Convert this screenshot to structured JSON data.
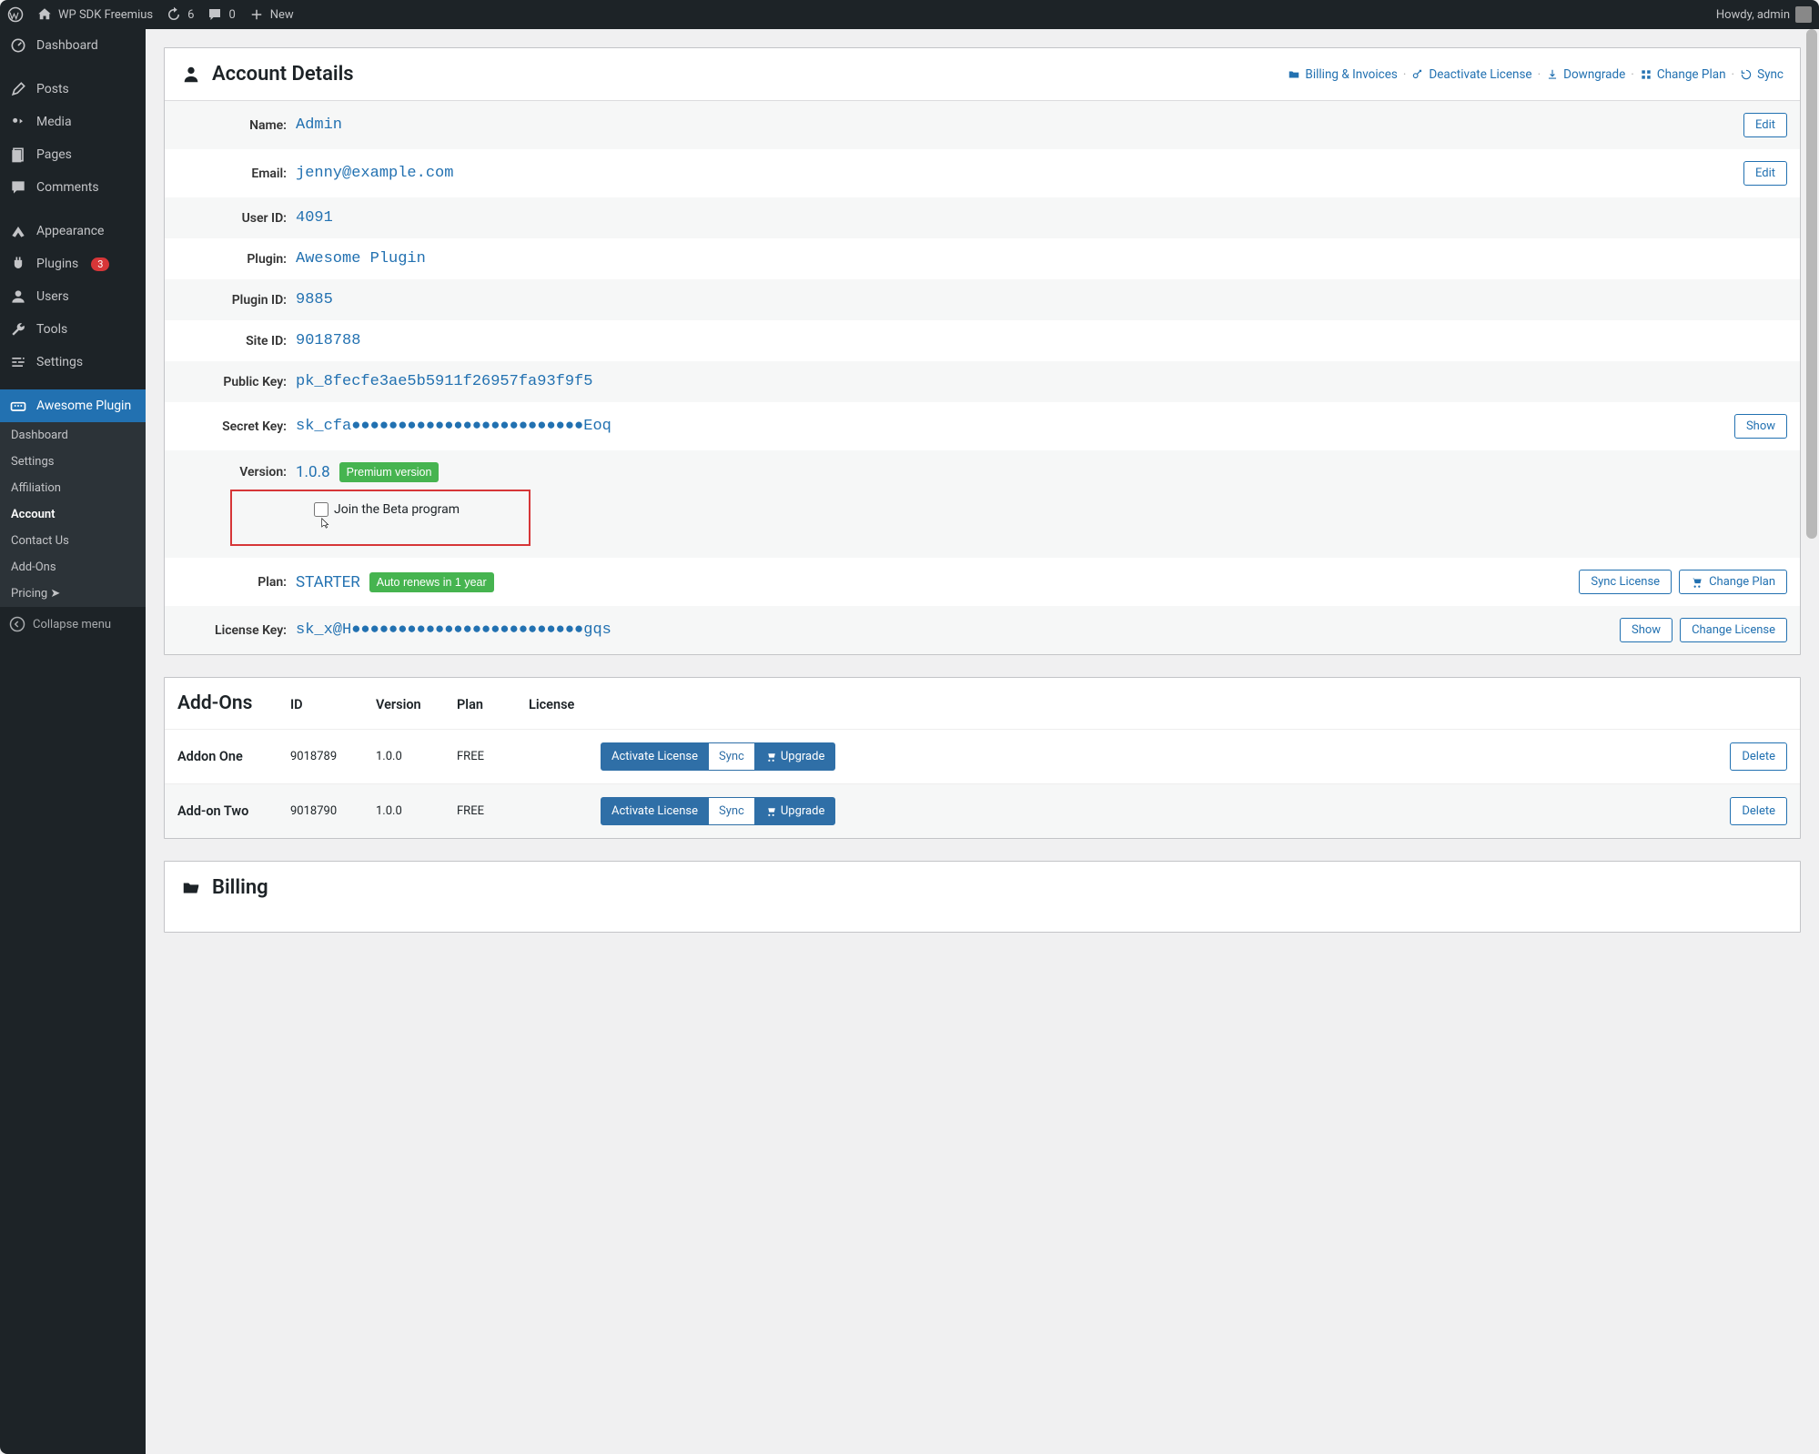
{
  "adminBar": {
    "siteName": "WP SDK Freemius",
    "updateCount": "6",
    "commentCount": "0",
    "newLabel": "New",
    "greeting": "Howdy, admin"
  },
  "sidebar": {
    "items": [
      {
        "label": "Dashboard"
      },
      {
        "label": "Posts"
      },
      {
        "label": "Media"
      },
      {
        "label": "Pages"
      },
      {
        "label": "Comments"
      },
      {
        "label": "Appearance"
      },
      {
        "label": "Plugins",
        "badge": "3"
      },
      {
        "label": "Users"
      },
      {
        "label": "Tools"
      },
      {
        "label": "Settings"
      },
      {
        "label": "Awesome Plugin"
      }
    ],
    "submenu": [
      {
        "label": "Dashboard"
      },
      {
        "label": "Settings"
      },
      {
        "label": "Affiliation"
      },
      {
        "label": "Account"
      },
      {
        "label": "Contact Us"
      },
      {
        "label": "Add-Ons"
      },
      {
        "label": "Pricing ➤"
      }
    ],
    "collapseLabel": "Collapse menu"
  },
  "accountDetails": {
    "title": "Account Details",
    "headerLinks": {
      "billing": "Billing & Invoices",
      "deactivate": "Deactivate License",
      "downgrade": "Downgrade",
      "changePlan": "Change Plan",
      "sync": "Sync"
    },
    "rows": {
      "nameLabel": "Name:",
      "nameValue": "Admin",
      "emailLabel": "Email:",
      "emailValue": "jenny@example.com",
      "userIdLabel": "User ID:",
      "userIdValue": "4091",
      "pluginLabel": "Plugin:",
      "pluginValue": "Awesome Plugin",
      "pluginIdLabel": "Plugin ID:",
      "pluginIdValue": "9885",
      "siteIdLabel": "Site ID:",
      "siteIdValue": "9018788",
      "publicKeyLabel": "Public Key:",
      "publicKeyValue": "pk_8fecfe3ae5b5911f26957fa93f9f5",
      "secretKeyLabel": "Secret Key:",
      "secretKeyValue": "sk_cfa●●●●●●●●●●●●●●●●●●●●●●●●●Eoq",
      "versionLabel": "Version:",
      "versionValue": "1.0.8",
      "versionBadge": "Premium version",
      "betaLabel": "Join the Beta program",
      "planLabel": "Plan:",
      "planValue": "STARTER",
      "planBadge": "Auto renews in 1 year",
      "licenseKeyLabel": "License Key:",
      "licenseKeyValue": "sk_x@H●●●●●●●●●●●●●●●●●●●●●●●●●gqs"
    },
    "buttons": {
      "edit": "Edit",
      "show": "Show",
      "syncLicense": "Sync License",
      "changePlan": "Change Plan",
      "changeLicense": "Change License"
    }
  },
  "addOns": {
    "title": "Add-Ons",
    "columns": {
      "id": "ID",
      "version": "Version",
      "plan": "Plan",
      "license": "License"
    },
    "rows": [
      {
        "name": "Addon One",
        "id": "9018789",
        "version": "1.0.0",
        "plan": "FREE"
      },
      {
        "name": "Add-on Two",
        "id": "9018790",
        "version": "1.0.0",
        "plan": "FREE"
      }
    ],
    "actions": {
      "activate": "Activate License",
      "sync": "Sync",
      "upgrade": "Upgrade",
      "delete": "Delete"
    }
  },
  "billing": {
    "title": "Billing"
  }
}
